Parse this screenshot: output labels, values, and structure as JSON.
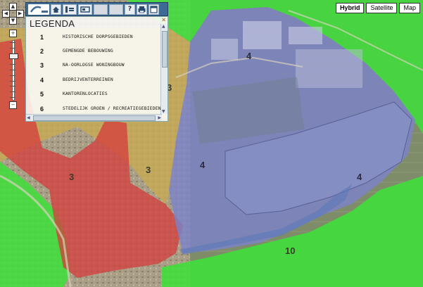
{
  "map_types": [
    {
      "label": "Hybrid",
      "active": true
    },
    {
      "label": "Satellite",
      "active": false
    },
    {
      "label": "Map",
      "active": false
    }
  ],
  "map_zones": [
    {
      "label": "4",
      "category": "bedrijventerreinen",
      "color": "#7d82c8"
    },
    {
      "label": "4",
      "category": "bedrijventerreinen",
      "color": "#7d82c8"
    },
    {
      "label": "4",
      "category": "bedrijventerreinen",
      "color": "#7d82c8"
    },
    {
      "label": "3",
      "category": "na-oorlogse woningbouw",
      "color": "#c8ab52"
    },
    {
      "label": "3",
      "category": "na-oorlogse woningbouw",
      "color": "#c8ab52"
    },
    {
      "label": "3",
      "category": "na-oorlogse woningbouw",
      "color": "#c8ab52"
    },
    {
      "label": "10",
      "category": "groen",
      "color": "#3ee03a"
    }
  ],
  "legend": {
    "title": "LEGENDA",
    "close_icon": "close-icon",
    "items": [
      {
        "number": "1",
        "label": "HISTORISCHE DORPSGEBIEDEN"
      },
      {
        "number": "2",
        "label": "GEMENGDE BEBOUWING"
      },
      {
        "number": "3",
        "label": "NA-OORLOGSE WONINGBOUW"
      },
      {
        "number": "4",
        "label": "BEDRIJVENTERREINEN"
      },
      {
        "number": "5",
        "label": "KANTORENLOCATIES"
      },
      {
        "number": "6",
        "label": "STEDELIJK GROEN / RECREATIEGEBIEDEN"
      }
    ]
  },
  "toolbar": {
    "icons": [
      "logo-icon",
      "home-icon",
      "info-icon",
      "layer-icon",
      "blank-button",
      "blank-button",
      "help-icon",
      "print-icon",
      "window-icon"
    ],
    "help_label": "?"
  },
  "colors": {
    "historic": "#d63b3b",
    "postwar": "#c8ab52",
    "industrial": "#7d82c8",
    "green": "#3ee03a",
    "water": "#7a86b8"
  },
  "zoom_level_fraction": 0.24
}
